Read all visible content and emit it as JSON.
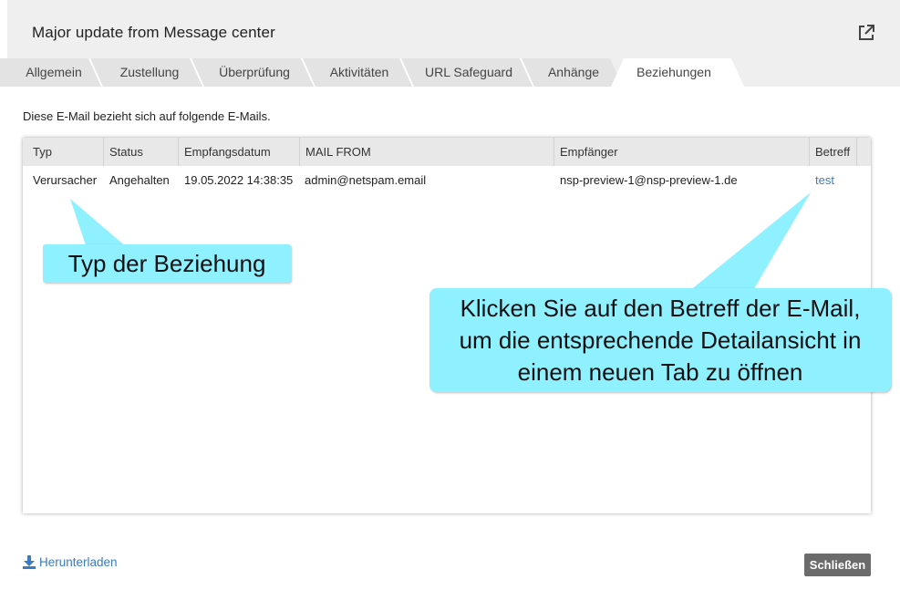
{
  "dialog": {
    "title": "Major update from Message center"
  },
  "tabs": [
    {
      "label": "Allgemein"
    },
    {
      "label": "Zustellung"
    },
    {
      "label": "Überprüfung"
    },
    {
      "label": "Aktivitäten"
    },
    {
      "label": "URL Safeguard"
    },
    {
      "label": "Anhänge"
    },
    {
      "label": "Beziehungen",
      "active": true
    }
  ],
  "intro_text": "Diese E-Mail bezieht sich auf folgende E-Mails.",
  "table": {
    "columns": [
      "Typ",
      "Status",
      "Empfangsdatum",
      "MAIL FROM",
      "Empfänger",
      "Betreff"
    ],
    "rows": [
      {
        "typ": "Verursacher",
        "status": "Angehalten",
        "empfangsdatum": "19.05.2022 14:38:35",
        "mail_from": "admin@netspam.email",
        "empfaenger": "nsp-preview-1@nsp-preview-1.de",
        "betreff": "test"
      }
    ]
  },
  "callouts": {
    "type": "Typ der Beziehung",
    "subject_line1": "Klicken Sie auf den Betreff der E-Mail,",
    "subject_line2": "um die entsprechende Detailansicht in",
    "subject_line3": "einem neuen Tab zu öffnen"
  },
  "footer": {
    "download_label": "Herunterladen",
    "close_label": "Schließen"
  },
  "icons": {
    "popout": "external-link-icon",
    "download": "download-icon"
  },
  "colors": {
    "accent_link": "#3b7bbf",
    "callout": "#8ff0ff",
    "close_button": "#6b6b6b"
  }
}
